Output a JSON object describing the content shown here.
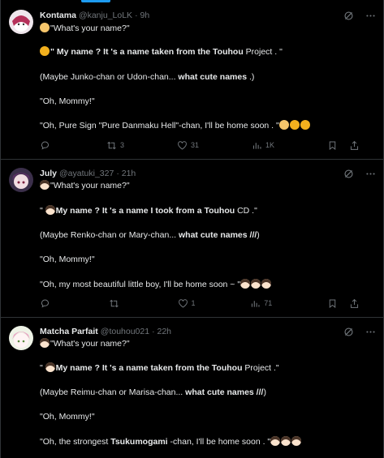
{
  "tweets": [
    {
      "name": "Kontama",
      "handle": "@kanju_LoLK",
      "time": "· 9h",
      "lines": [
        {
          "parts": [
            "\"What's your name?\""
          ]
        },
        {
          "parts": [
            "\" My name ? It 's a name taken from the Touhou",
            " Project . \""
          ]
        },
        {
          "parts": [
            "(Maybe Junko-chan or Udon-chan...",
            " what cute names",
            " .)"
          ]
        },
        {
          "parts": [
            "\"Oh, Mommy!\""
          ]
        },
        {
          "parts": [
            "\"Oh, Pure Sign \"Pure Danmaku Hell\"-chan, I'll be home soon . \""
          ]
        }
      ],
      "stats": {
        "reply": "",
        "retweet": "3",
        "like": "31",
        "views": "1K"
      }
    },
    {
      "name": "July",
      "handle": "@ayatuki_327",
      "time": "· 21h",
      "lines": [
        {
          "parts": [
            "\"What's your name?\""
          ]
        },
        {
          "parts": [
            "\" ",
            "My name ? It 's a name I took from a Touhou",
            " CD .\""
          ]
        },
        {
          "parts": [
            "(Maybe Renko-chan or Mary-chan...",
            " what cute names ///",
            ")"
          ]
        },
        {
          "parts": [
            "\"Oh, Mommy!\""
          ]
        },
        {
          "parts": [
            "\"Oh, my most beautiful little boy, I'll be home soon ~ \""
          ]
        }
      ],
      "stats": {
        "reply": "",
        "retweet": "",
        "like": "1",
        "views": "71"
      }
    },
    {
      "name": "Matcha Parfait",
      "handle": "@touhou021",
      "time": "· 22h",
      "lines": [
        {
          "parts": [
            "\"What's your name?\""
          ]
        },
        {
          "parts": [
            "\" ",
            "My name ? It 's a name taken from the Touhou",
            " Project .\""
          ]
        },
        {
          "parts": [
            "(Maybe Reimu-chan or Marisa-chan...",
            " what cute names ///",
            ")"
          ]
        },
        {
          "parts": [
            "\"Oh, Mommy!\""
          ]
        },
        {
          "parts": [
            "\"Oh, the strongest ",
            "Tsukumogami",
            " -chan, I'll be home soon . \""
          ]
        }
      ],
      "stats": {
        "reply": "",
        "retweet": "",
        "like": "",
        "views": ""
      }
    }
  ],
  "colors": {
    "background": "#000000",
    "text": "#e7e9ea",
    "muted": "#71767b",
    "border": "#2f3336",
    "accent": "#1d9bf0"
  },
  "icons": [
    "grok-icon",
    "more-icon",
    "reply-icon",
    "retweet-icon",
    "like-icon",
    "views-icon",
    "bookmark-icon",
    "share-icon"
  ]
}
